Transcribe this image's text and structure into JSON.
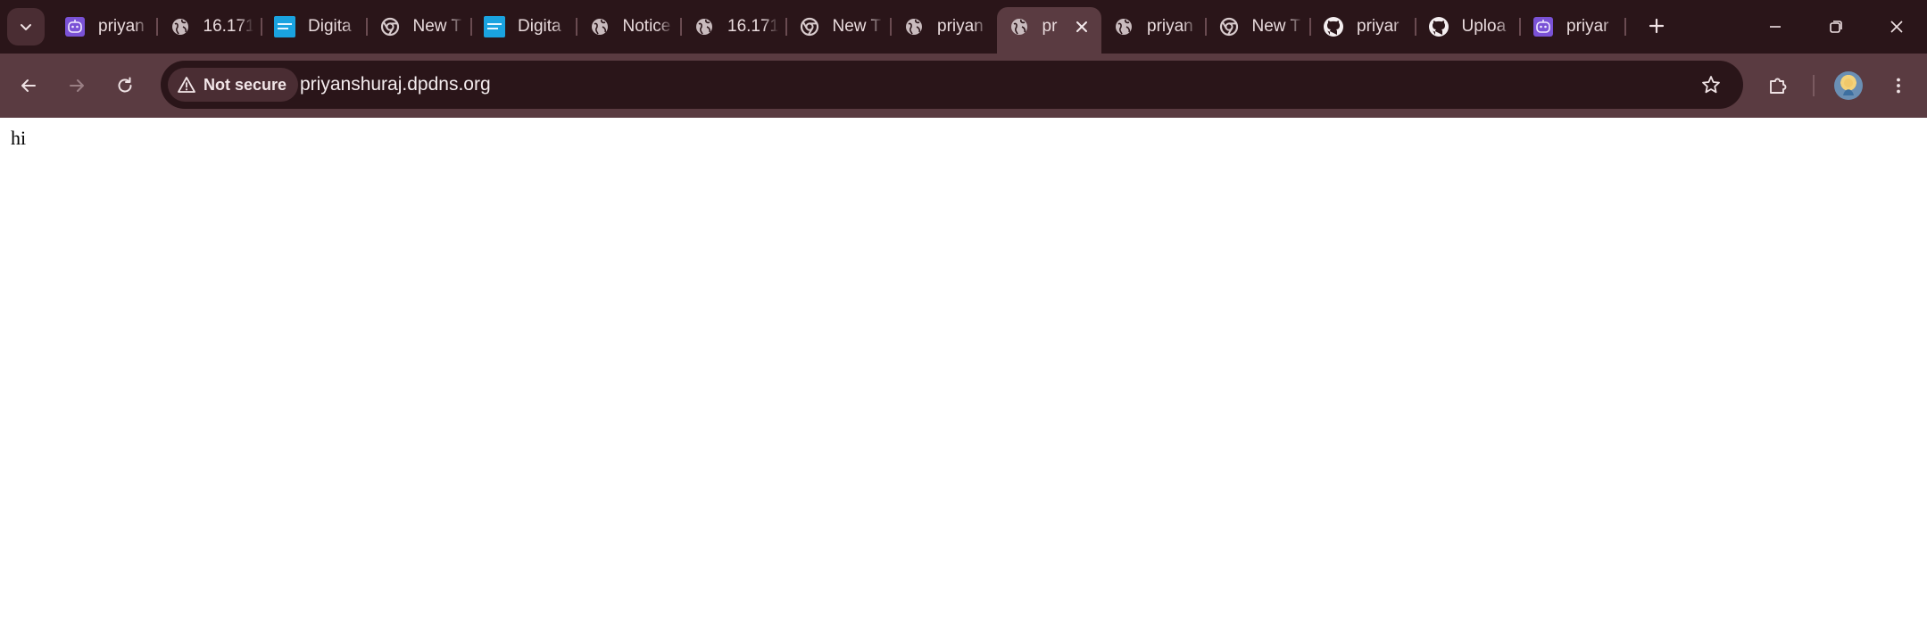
{
  "browser": {
    "tabs": [
      {
        "title": "priyan",
        "icon": "purple-robot-icon",
        "active": false
      },
      {
        "title": "16.171",
        "icon": "globe-icon",
        "active": false
      },
      {
        "title": "Digita",
        "icon": "digital-blue-logo-icon",
        "active": false
      },
      {
        "title": "New T",
        "icon": "chrome-icon",
        "active": false
      },
      {
        "title": "Digita",
        "icon": "digital-blue-logo-icon",
        "active": false
      },
      {
        "title": "Notice",
        "icon": "globe-icon",
        "active": false
      },
      {
        "title": "16.171",
        "icon": "globe-icon",
        "active": false
      },
      {
        "title": "New T",
        "icon": "chrome-icon",
        "active": false
      },
      {
        "title": "priyan",
        "icon": "globe-icon",
        "active": false
      },
      {
        "title": "pr",
        "icon": "globe-icon",
        "active": true
      },
      {
        "title": "priyan",
        "icon": "globe-icon",
        "active": false
      },
      {
        "title": "New T",
        "icon": "chrome-icon",
        "active": false
      },
      {
        "title": "priyar",
        "icon": "github-icon",
        "active": false
      },
      {
        "title": "Uploa",
        "icon": "github-icon",
        "active": false
      },
      {
        "title": "priyar",
        "icon": "purple-robot-icon",
        "active": false
      }
    ],
    "security_chip": "Not secure",
    "url": "priyanshuraj.dpdns.org"
  },
  "page": {
    "body_text": "hi"
  },
  "colors": {
    "tabstrip_bg": "#2a1519",
    "toolbar_bg": "#5a3b41",
    "omnibox_bg": "#2a1519"
  }
}
